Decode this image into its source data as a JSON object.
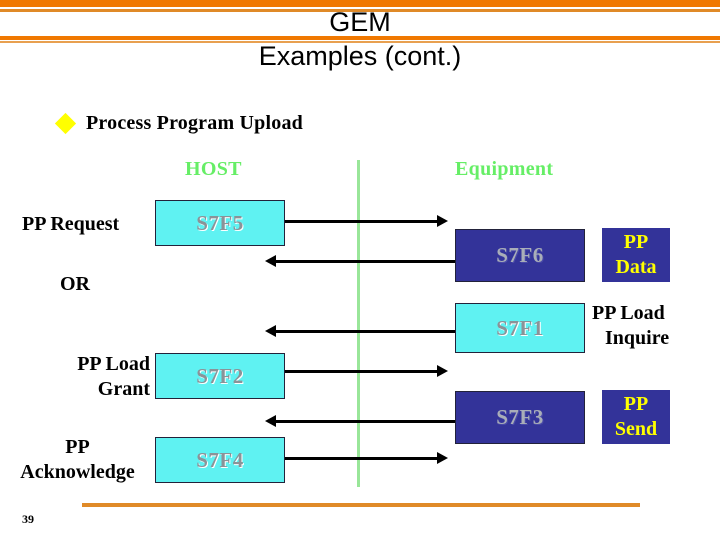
{
  "slide": {
    "title_line1": "GEM",
    "title_line2": "Examples (cont.)",
    "page_number": "39",
    "accent_orange": "#F07800",
    "accent_orange_thin": "#E08A28"
  },
  "bullet": {
    "marker": "diamond-bullet-icon",
    "text": "Process Program Upload"
  },
  "columns": {
    "host": "HOST",
    "equipment": "Equipment",
    "divider_color": "#99E699",
    "header_color": "#66EE66"
  },
  "diagram": {
    "host_boxes": [
      {
        "id": "s7f5",
        "label": "S7F5"
      },
      {
        "id": "s7f2",
        "label": "S7F2"
      },
      {
        "id": "s7f4",
        "label": "S7F4"
      }
    ],
    "host_box_color": "#5FF2F2",
    "equip_boxes": [
      {
        "id": "s7f6",
        "label": "S7F6"
      },
      {
        "id": "s7f1",
        "label": "S7F1"
      },
      {
        "id": "s7f3",
        "label": "S7F3"
      }
    ],
    "equip_box_color": "#333399",
    "host_labels": [
      {
        "id": "pp-request",
        "text": "PP Request"
      },
      {
        "id": "or",
        "text": "OR"
      },
      {
        "id": "pp-load-grant",
        "line1": "PP Load",
        "line2": "Grant"
      },
      {
        "id": "pp-acknowledge",
        "line1": "PP",
        "line2": "Acknowledge"
      }
    ],
    "equip_labels": [
      {
        "id": "pp-data",
        "line1": "PP",
        "line2": "Data"
      },
      {
        "id": "pp-load-inquire",
        "line1": "PP Load",
        "line2": "Inquire"
      },
      {
        "id": "pp-send",
        "line1": "PP",
        "line2": "Send"
      }
    ],
    "arrows": [
      {
        "id": "arrow-s7f5",
        "direction": "right"
      },
      {
        "id": "arrow-s7f6",
        "direction": "left"
      },
      {
        "id": "arrow-s7f1",
        "direction": "left"
      },
      {
        "id": "arrow-s7f2",
        "direction": "right"
      },
      {
        "id": "arrow-s7f3",
        "direction": "left"
      },
      {
        "id": "arrow-s7f4",
        "direction": "right"
      }
    ]
  }
}
